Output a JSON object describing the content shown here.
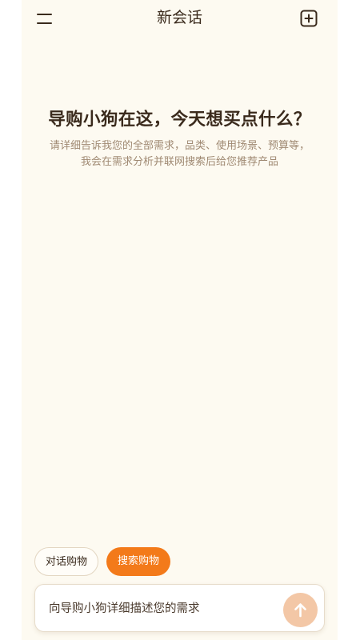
{
  "header": {
    "title": "新会话",
    "menu_icon": "menu-icon",
    "new_chat_icon": "new-chat-icon"
  },
  "welcome": {
    "title": "导购小狗在这，今天想买点什么？",
    "subtitle_line1": "请详细告诉我您的全部需求，品类、使用场景、预算等，",
    "subtitle_line2": "我会在需求分析并联网搜索后给您推荐产品"
  },
  "modes": [
    {
      "label": "对话购物",
      "selected": false
    },
    {
      "label": "搜索购物",
      "selected": true
    }
  ],
  "input": {
    "placeholder": "向导购小狗详细描述您的需求",
    "value": "",
    "send_icon": "arrow-up-icon"
  },
  "colors": {
    "background": "#fdfaf1",
    "text": "#3a2a1c",
    "subtext": "#a08a73",
    "accent": "#f37a1a",
    "send_button_disabled": "#f3c7a6"
  }
}
